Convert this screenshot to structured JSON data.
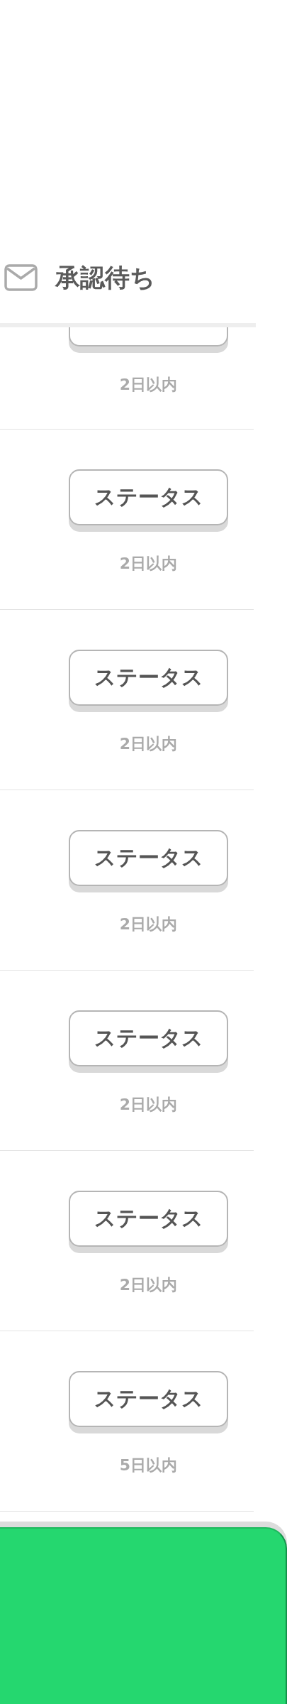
{
  "header": {
    "title": "承認待ち"
  },
  "rows": [
    {
      "deadline": "2日以内"
    },
    {
      "button_label": "ステータス",
      "deadline": "2日以内"
    },
    {
      "button_label": "ステータス",
      "deadline": "2日以内"
    },
    {
      "button_label": "ステータス",
      "deadline": "2日以内"
    },
    {
      "button_label": "ステータス",
      "deadline": "2日以内"
    },
    {
      "button_label": "ステータス",
      "deadline": "2日以内"
    },
    {
      "button_label": "ステータス",
      "deadline": "5日以内"
    }
  ]
}
